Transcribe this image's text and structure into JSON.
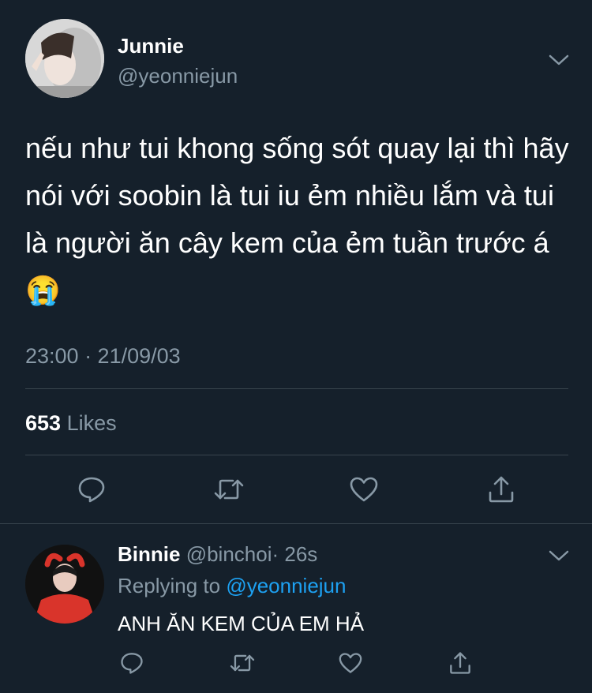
{
  "tweet": {
    "author_name": "Junnie",
    "author_handle": "@yeonniejun",
    "text": "nếu như tui khong sống sót quay lại thì hãy nói với soobin là tui iu ẻm nhiều lắm và tui là người ăn cây kem của ẻm tuần trước á 😭",
    "timestamp": "23:00 · 21/09/03",
    "likes_count": "653",
    "likes_label": "Likes"
  },
  "reply": {
    "author_name": "Binnie",
    "author_handle": "@binchoi",
    "time_ago": "· 26s",
    "replying_to_label": "Replying to",
    "replying_to_handle": "@yeonniejun",
    "text": "ANH ĂN KEM CỦA EM HẢ"
  },
  "colors": {
    "background": "#15202b",
    "text": "#ffffff",
    "muted": "#8899a6",
    "link": "#1da1f2",
    "divider": "#38444d"
  },
  "icons": [
    "chevron-down-icon",
    "reply-icon",
    "retweet-icon",
    "like-icon",
    "share-icon"
  ]
}
